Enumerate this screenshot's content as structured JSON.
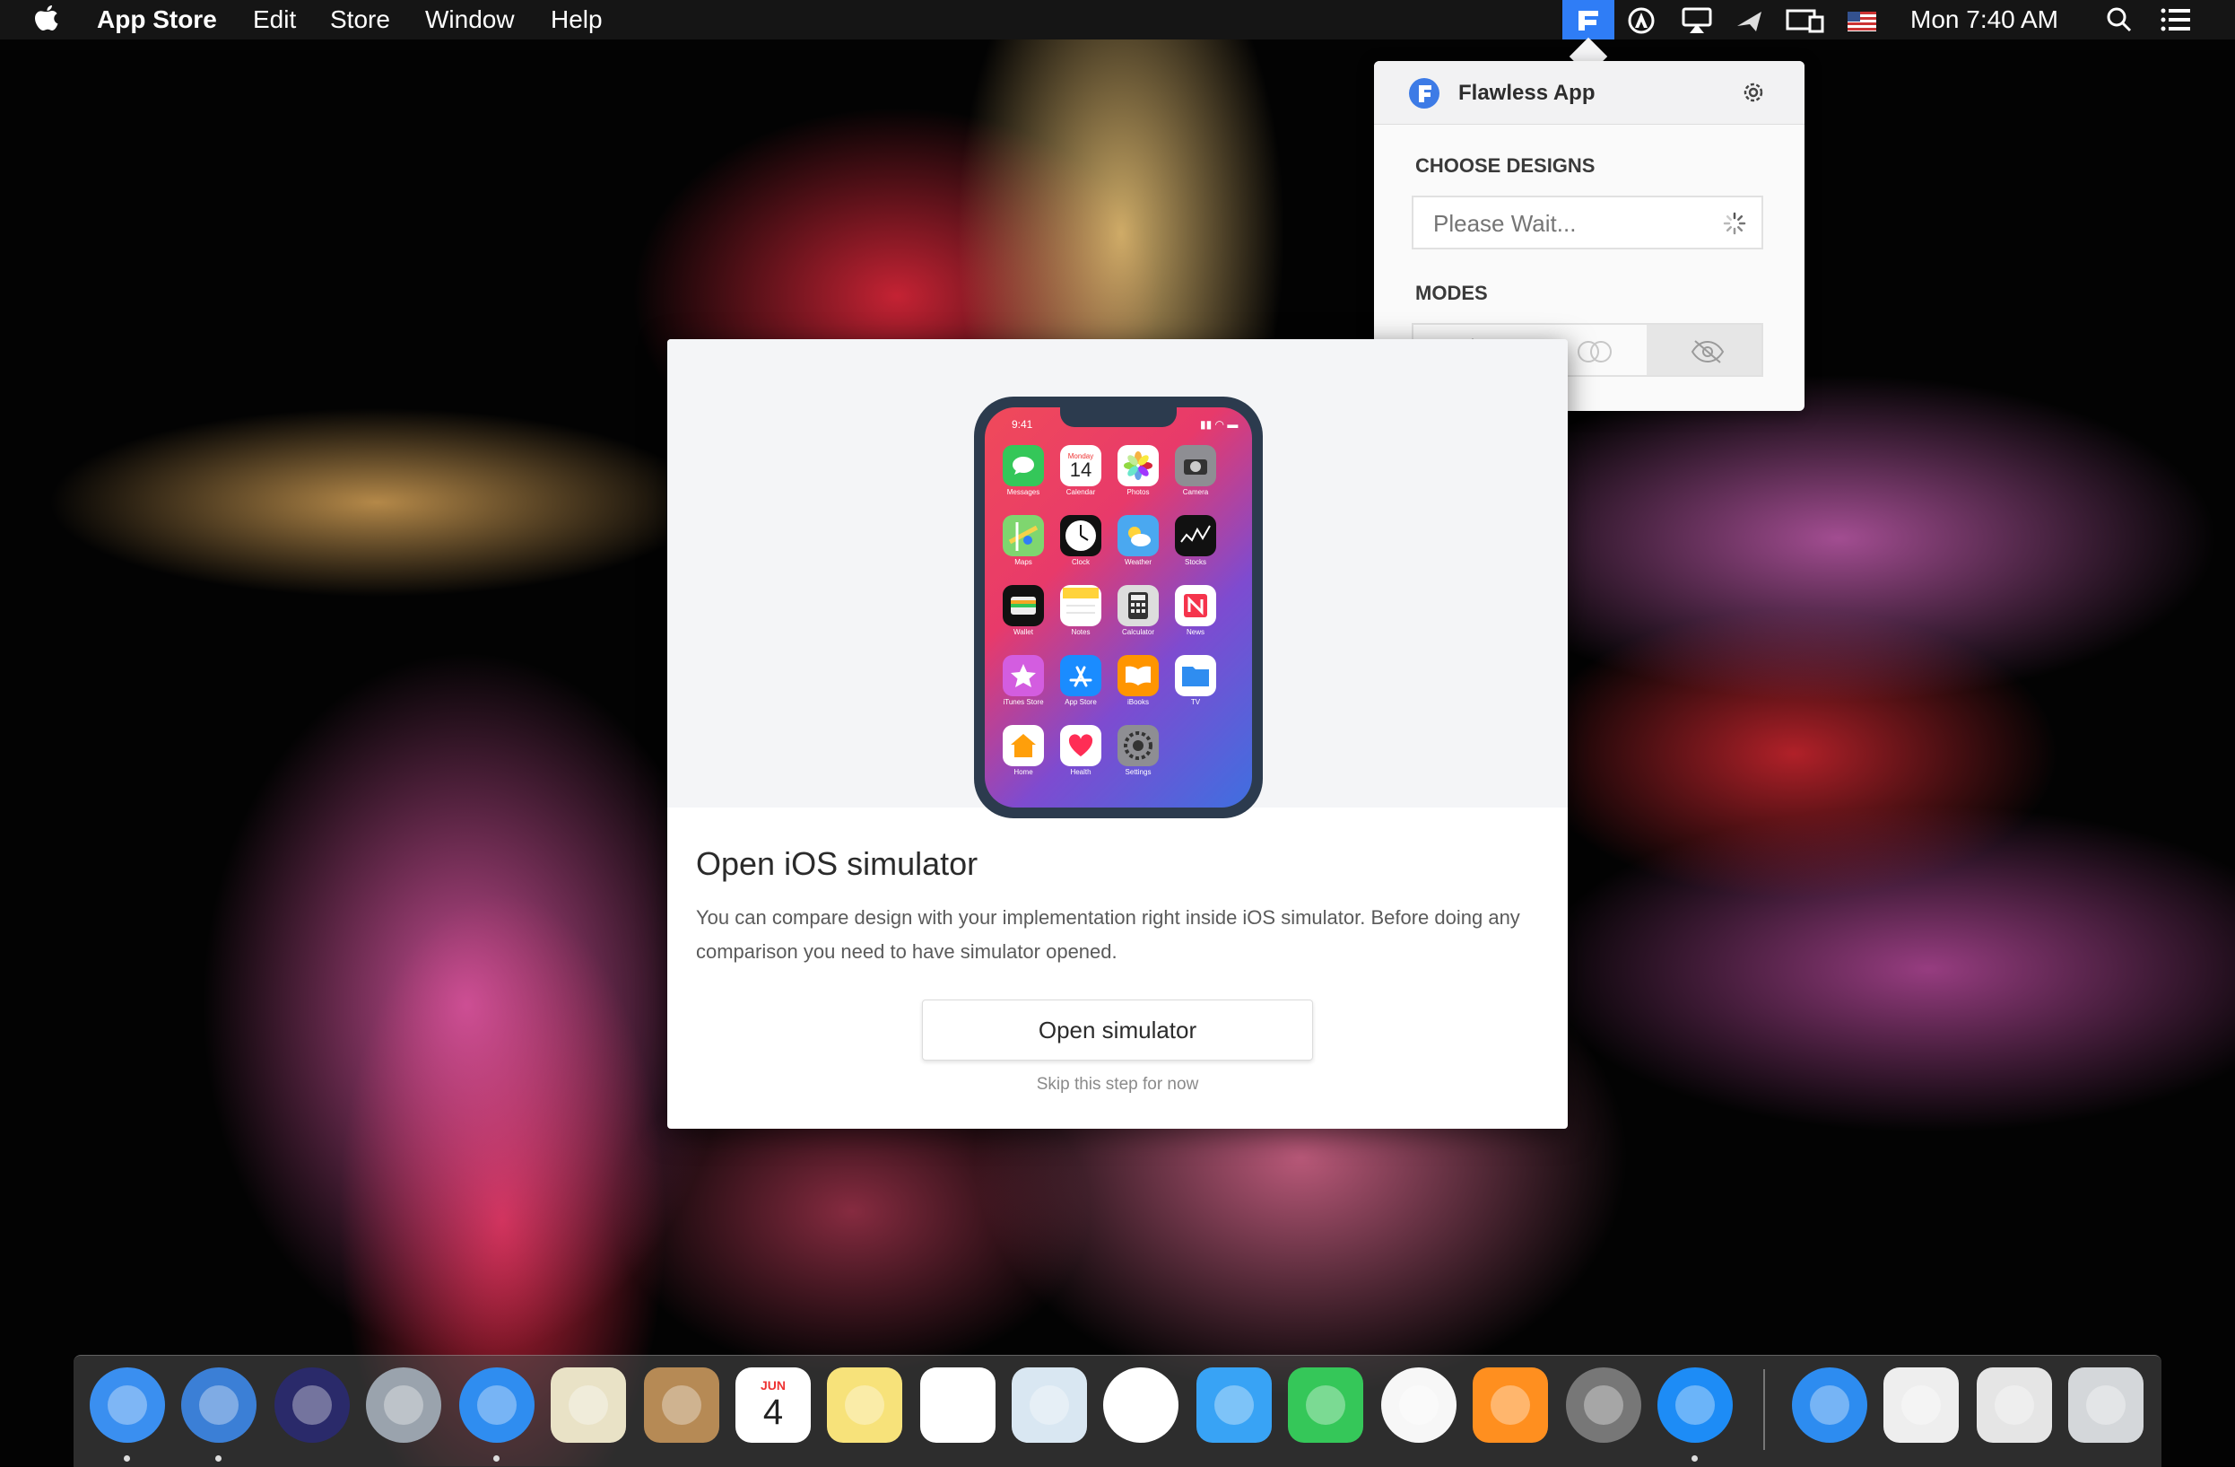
{
  "menubar": {
    "app_name": "App Store",
    "menus": [
      "Edit",
      "Store",
      "Window",
      "Help"
    ],
    "clock": "Mon 7:40 AM",
    "accent": "#2f7df6"
  },
  "popover": {
    "app_title": "Flawless App",
    "choose_designs_label": "CHOOSE DESIGNS",
    "design_placeholder": "Please Wait...",
    "modes_label": "MODES",
    "modes": [
      "overlay-mode",
      "side-by-side-mode",
      "hide-mode"
    ],
    "active_mode": "hide-mode"
  },
  "window": {
    "title": "Open iOS simulator",
    "description": "You can compare design with your implementation right inside iOS simulator. Before doing any comparison you need to have simulator opened.",
    "primary_button": "Open simulator",
    "skip_link": "Skip this step for now"
  },
  "phone": {
    "status_time": "9:41",
    "calendar_day": "Monday",
    "calendar_date": "14",
    "apps": [
      {
        "label": "Messages",
        "color": "#34c759"
      },
      {
        "label": "Calendar",
        "color": "#ffffff"
      },
      {
        "label": "Photos",
        "color": "#ffffff"
      },
      {
        "label": "Camera",
        "color": "#8e8e93"
      },
      {
        "label": "Maps",
        "color": "#7fd66f"
      },
      {
        "label": "Clock",
        "color": "#111111"
      },
      {
        "label": "Weather",
        "color": "#4aa8f0"
      },
      {
        "label": "Stocks",
        "color": "#111111"
      },
      {
        "label": "Wallet",
        "color": "#111111"
      },
      {
        "label": "Notes",
        "color": "#ffffff"
      },
      {
        "label": "Calculator",
        "color": "#dddddd"
      },
      {
        "label": "News",
        "color": "#ffffff"
      },
      {
        "label": "iTunes Store",
        "color": "#d35de0"
      },
      {
        "label": "App Store",
        "color": "#1a8cff"
      },
      {
        "label": "iBooks",
        "color": "#ff9500"
      },
      {
        "label": "TV",
        "color": "#ffffff"
      },
      {
        "label": "Home",
        "color": "#ffffff"
      },
      {
        "label": "Health",
        "color": "#ffffff"
      },
      {
        "label": "Settings",
        "color": "#8e8e93"
      }
    ]
  },
  "dock": {
    "calendar_month": "JUN",
    "calendar_date": "4",
    "apps": [
      {
        "name": "finder-icon",
        "color": "#3a8ff0"
      },
      {
        "name": "maps-compass-icon",
        "color": "#3b7fd6"
      },
      {
        "name": "siri-icon",
        "color": "#2a2a6a"
      },
      {
        "name": "launchpad-icon",
        "color": "#9aa3ad"
      },
      {
        "name": "safari-icon",
        "color": "#2f8df0"
      },
      {
        "name": "mail-icon",
        "color": "#e9e2c6"
      },
      {
        "name": "contacts-icon",
        "color": "#b68a55"
      },
      {
        "name": "calendar-icon",
        "color": "#ffffff"
      },
      {
        "name": "notes-icon",
        "color": "#f7e27a"
      },
      {
        "name": "reminders-icon",
        "color": "#ffffff"
      },
      {
        "name": "preview-icon",
        "color": "#d9e7f2"
      },
      {
        "name": "photos-icon",
        "color": "#ffffff"
      },
      {
        "name": "messages-icon",
        "color": "#38a3f5"
      },
      {
        "name": "facetime-icon",
        "color": "#35c759"
      },
      {
        "name": "itunes-icon",
        "color": "#f7f7f7"
      },
      {
        "name": "ibooks-icon",
        "color": "#ff8f1f"
      },
      {
        "name": "system-preferences-icon",
        "color": "#777777"
      },
      {
        "name": "app-store-icon",
        "color": "#1d8cf6"
      },
      {
        "name": "app-store-download-icon",
        "color": "#2d8cf0"
      },
      {
        "name": "quicktime-file-icon",
        "color": "#eeeeee"
      },
      {
        "name": "app-installer-icon",
        "color": "#e5e5e5"
      },
      {
        "name": "trash-icon",
        "color": "#d4d7da"
      }
    ]
  }
}
